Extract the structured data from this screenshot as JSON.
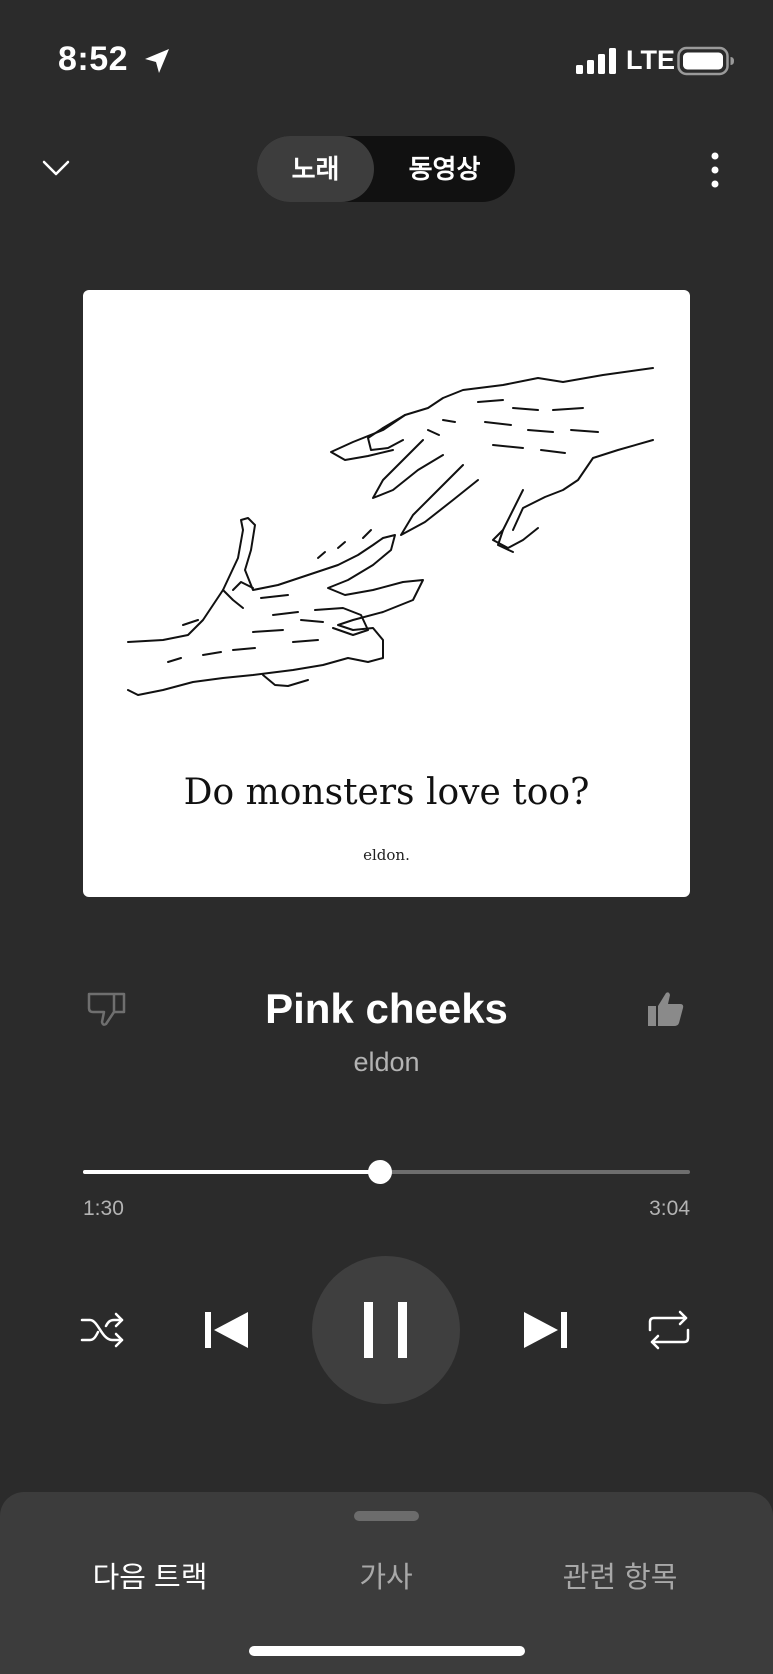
{
  "status_bar": {
    "time": "8:52",
    "network": "LTE",
    "location_icon": "location-arrow-icon",
    "signal_icon": "cellular-signal-icon",
    "battery_icon": "battery-icon"
  },
  "header": {
    "toggle": {
      "song_label": "노래",
      "video_label": "동영상",
      "selected": "song"
    },
    "collapse_icon": "chevron-down-icon",
    "more_icon": "more-vertical-icon"
  },
  "album_art": {
    "title": "Do monsters love too?",
    "artist": "eldon."
  },
  "track": {
    "title": "Pink cheeks",
    "artist": "eldon",
    "dislike_icon": "thumbs-down-icon",
    "like_icon": "thumbs-up-icon"
  },
  "playback": {
    "elapsed": "1:30",
    "total": "3:04",
    "progress_fraction": 0.49
  },
  "controls": {
    "shuffle_icon": "shuffle-icon",
    "previous_icon": "skip-previous-icon",
    "pause_icon": "pause-icon",
    "next_icon": "skip-next-icon",
    "repeat_icon": "repeat-icon"
  },
  "bottom_sheet": {
    "tabs": [
      {
        "label": "다음 트랙",
        "active": true
      },
      {
        "label": "가사",
        "active": false
      },
      {
        "label": "관련 항목",
        "active": false
      }
    ]
  },
  "colors": {
    "background": "#2b2b2b",
    "sheet": "#3c3c3c",
    "accent": "#ffffff",
    "secondary_text": "#b3b3b3"
  }
}
